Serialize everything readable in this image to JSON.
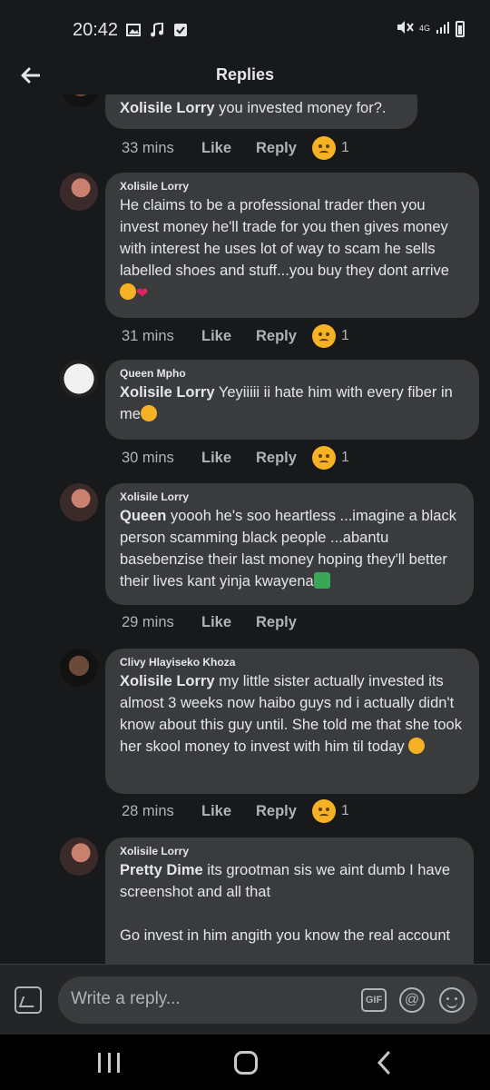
{
  "status_bar": {
    "time": "20:42",
    "network": "4G"
  },
  "header": {
    "title": "Replies"
  },
  "comments": [
    {
      "author": "",
      "mention": "Xolisile Lorry",
      "text": " you invested money for?.",
      "time": "33 mins",
      "like": "Like",
      "reply": "Reply",
      "reaction_count": "1"
    },
    {
      "author": "Xolisile Lorry",
      "mention": "",
      "text": "He claims to be a professional trader then you invest money he'll trade for you then gives money with interest he uses lot of way to scam he sells labelled shoes and stuff...you buy they dont arrive",
      "time": "31 mins",
      "like": "Like",
      "reply": "Reply",
      "reaction_count": "1"
    },
    {
      "author": "Queen Mpho",
      "mention": "Xolisile Lorry",
      "text": " Yeyiiiii ii hate him with every fiber in me",
      "time": "30 mins",
      "like": "Like",
      "reply": "Reply",
      "reaction_count": "1"
    },
    {
      "author": "Xolisile Lorry",
      "mention": "Queen",
      "text": " yoooh he's  soo heartless ...imagine a black person scamming black people ...abantu basebenzise their last money hoping they'll better their lives kant yinja kwayena",
      "time": "29 mins",
      "like": "Like",
      "reply": "Reply",
      "reaction_count": ""
    },
    {
      "author": "Clivy Hlayiseko Khoza",
      "mention": "Xolisile Lorry",
      "text": " my little sister actually invested its almost 3 weeks now haibo guys nd i actually didn't know about this guy until. She told me that she took her skool money to invest with him til today ",
      "time": "28 mins",
      "like": "Like",
      "reply": "Reply",
      "reaction_count": "1"
    },
    {
      "author": "Xolisile Lorry",
      "mention": "Pretty Dime",
      "text": " its grootman sis we aint dumb I have screenshot and all that",
      "text2": "Go invest in him angith you know the real account",
      "time": "",
      "like": "",
      "reply": "",
      "reaction_count": ""
    }
  ],
  "input_bar": {
    "placeholder": "Write a reply...",
    "gif_label": "GIF",
    "at_label": "@"
  },
  "icons": {
    "back": "arrow-left-icon",
    "photo": "photo-icon",
    "gif": "gif-icon",
    "mention": "at-icon",
    "emoji": "smiley-icon"
  },
  "colors": {
    "background": "#18191a",
    "bubble": "#3a3b3c",
    "text": "#e4e6eb",
    "muted": "#b0b3b8",
    "reaction": "#f7b125"
  }
}
